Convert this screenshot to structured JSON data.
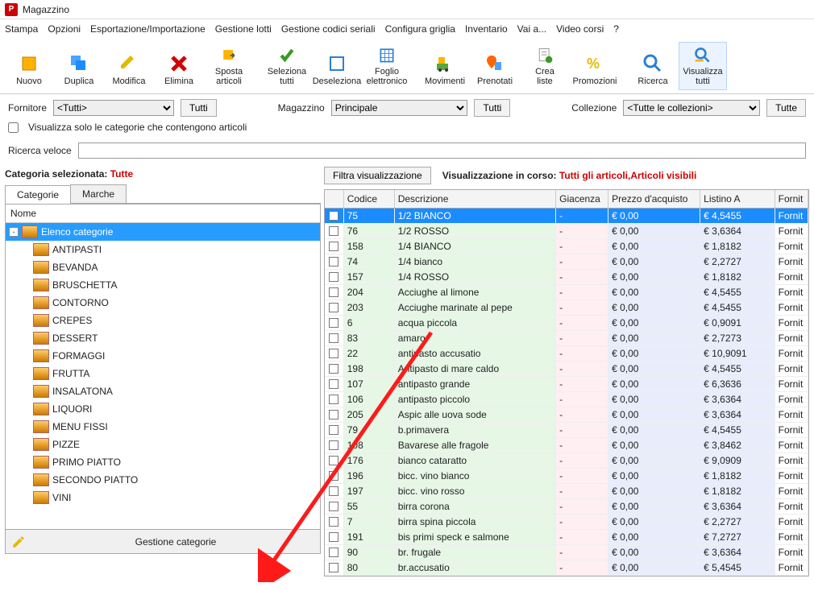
{
  "window_title": "Magazzino",
  "menu": [
    "Stampa",
    "Opzioni",
    "Esportazione/Importazione",
    "Gestione lotti",
    "Gestione codici seriali",
    "Configura griglia",
    "Inventario",
    "Vai a...",
    "Video corsi",
    "?"
  ],
  "toolbar": [
    {
      "label": "Nuovo"
    },
    {
      "label": "Duplica"
    },
    {
      "label": "Modifica"
    },
    {
      "label": "Elimina"
    },
    {
      "label": "Sposta articoli"
    },
    {
      "label": "Seleziona tutti"
    },
    {
      "label": "Deseleziona"
    },
    {
      "label": "Foglio elettronico"
    },
    {
      "label": "Movimenti"
    },
    {
      "label": "Prenotati"
    },
    {
      "label": "Crea liste"
    },
    {
      "label": "Promozioni"
    },
    {
      "label": "Ricerca"
    },
    {
      "label": "Visualizza tutti"
    }
  ],
  "filters": {
    "fornitore_label": "Fornitore",
    "fornitore_value": "<Tutti>",
    "fornitore_btn": "Tutti",
    "magazzino_label": "Magazzino",
    "magazzino_value": "Principale",
    "magazzino_btn": "Tutti",
    "collezione_label": "Collezione",
    "collezione_value": "<Tutte le collezioni>",
    "collezione_btn": "Tutte",
    "only_categories_with_items": "Visualizza solo le categorie che contengono articoli",
    "quicksearch_label": "Ricerca veloce",
    "quicksearch_value": ""
  },
  "category_label": "Categoria selezionata:",
  "category_value": "Tutte",
  "tabs": [
    "Categorie",
    "Marche"
  ],
  "tree_header": "Nome",
  "tree_root": "Elenco categorie",
  "categories": [
    "ANTIPASTI",
    "BEVANDA",
    "BRUSCHETTA",
    "CONTORNO",
    "CREPES",
    "DESSERT",
    "FORMAGGI",
    "FRUTTA",
    "INSALATONA",
    "LIQUORI",
    "MENU FISSI",
    "PIZZE",
    "PRIMO PIATTO",
    "SECONDO PIATTO",
    "VINI"
  ],
  "gest_cat": "Gestione categorie",
  "filter_vis_btn": "Filtra visualizzazione",
  "vis_label": "Visualizzazione in corso:",
  "vis_value": "Tutti gli articoli,Articoli visibili",
  "grid_headers": [
    "",
    "Codice",
    "Descrizione",
    "Giacenza",
    "Prezzo d'acquisto",
    "Listino A",
    "Fornit"
  ],
  "rows": [
    {
      "cod": "75",
      "desc": "1/2 BIANCO",
      "gia": "-",
      "prz": "€ 0,00",
      "lis": "€ 4,5455",
      "for": "Fornit",
      "sel": true
    },
    {
      "cod": "76",
      "desc": "1/2 ROSSO",
      "gia": "-",
      "prz": "€ 0,00",
      "lis": "€ 3,6364",
      "for": "Fornit"
    },
    {
      "cod": "158",
      "desc": "1/4 BIANCO",
      "gia": "-",
      "prz": "€ 0,00",
      "lis": "€ 1,8182",
      "for": "Fornit"
    },
    {
      "cod": "74",
      "desc": "1/4 bianco",
      "gia": "-",
      "prz": "€ 0,00",
      "lis": "€ 2,2727",
      "for": "Fornit"
    },
    {
      "cod": "157",
      "desc": "1/4 ROSSO",
      "gia": "-",
      "prz": "€ 0,00",
      "lis": "€ 1,8182",
      "for": "Fornit"
    },
    {
      "cod": "204",
      "desc": "Acciughe al limone",
      "gia": "-",
      "prz": "€ 0,00",
      "lis": "€ 4,5455",
      "for": "Fornit"
    },
    {
      "cod": "203",
      "desc": "Acciughe marinate al pepe",
      "gia": "-",
      "prz": "€ 0,00",
      "lis": "€ 4,5455",
      "for": "Fornit"
    },
    {
      "cod": "6",
      "desc": "acqua piccola",
      "gia": "-",
      "prz": "€ 0,00",
      "lis": "€ 0,9091",
      "for": "Fornit"
    },
    {
      "cod": "83",
      "desc": "amaro",
      "gia": "-",
      "prz": "€ 0,00",
      "lis": "€ 2,7273",
      "for": "Fornit"
    },
    {
      "cod": "22",
      "desc": "antipasto accusatio",
      "gia": "-",
      "prz": "€ 0,00",
      "lis": "€ 10,9091",
      "for": "Fornit"
    },
    {
      "cod": "198",
      "desc": "Antipasto di mare caldo",
      "gia": "-",
      "prz": "€ 0,00",
      "lis": "€ 4,5455",
      "for": "Fornit"
    },
    {
      "cod": "107",
      "desc": "antipasto grande",
      "gia": "-",
      "prz": "€ 0,00",
      "lis": "€ 6,3636",
      "for": "Fornit"
    },
    {
      "cod": "106",
      "desc": "antipasto piccolo",
      "gia": "-",
      "prz": "€ 0,00",
      "lis": "€ 3,6364",
      "for": "Fornit"
    },
    {
      "cod": "205",
      "desc": "Aspic alle uova sode",
      "gia": "-",
      "prz": "€ 0,00",
      "lis": "€ 3,6364",
      "for": "Fornit"
    },
    {
      "cod": "79",
      "desc": "b.primavera",
      "gia": "-",
      "prz": "€ 0,00",
      "lis": "€ 4,5455",
      "for": "Fornit"
    },
    {
      "cod": "108",
      "desc": "Bavarese alle fragole",
      "gia": "-",
      "prz": "€ 0,00",
      "lis": "€ 3,8462",
      "for": "Fornit"
    },
    {
      "cod": "176",
      "desc": "bianco cataratto",
      "gia": "-",
      "prz": "€ 0,00",
      "lis": "€ 9,0909",
      "for": "Fornit"
    },
    {
      "cod": "196",
      "desc": "bicc. vino bianco",
      "gia": "-",
      "prz": "€ 0,00",
      "lis": "€ 1,8182",
      "for": "Fornit"
    },
    {
      "cod": "197",
      "desc": "bicc. vino rosso",
      "gia": "-",
      "prz": "€ 0,00",
      "lis": "€ 1,8182",
      "for": "Fornit"
    },
    {
      "cod": "55",
      "desc": "birra corona",
      "gia": "-",
      "prz": "€ 0,00",
      "lis": "€ 3,6364",
      "for": "Fornit"
    },
    {
      "cod": "7",
      "desc": "birra spina piccola",
      "gia": "-",
      "prz": "€ 0,00",
      "lis": "€ 2,2727",
      "for": "Fornit"
    },
    {
      "cod": "191",
      "desc": "bis primi speck e salmone",
      "gia": "-",
      "prz": "€ 0,00",
      "lis": "€ 7,2727",
      "for": "Fornit"
    },
    {
      "cod": "90",
      "desc": "br. frugale",
      "gia": "-",
      "prz": "€ 0,00",
      "lis": "€ 3,6364",
      "for": "Fornit"
    },
    {
      "cod": "80",
      "desc": "br.accusatio",
      "gia": "-",
      "prz": "€ 0,00",
      "lis": "€ 5,4545",
      "for": "Fornit"
    }
  ]
}
